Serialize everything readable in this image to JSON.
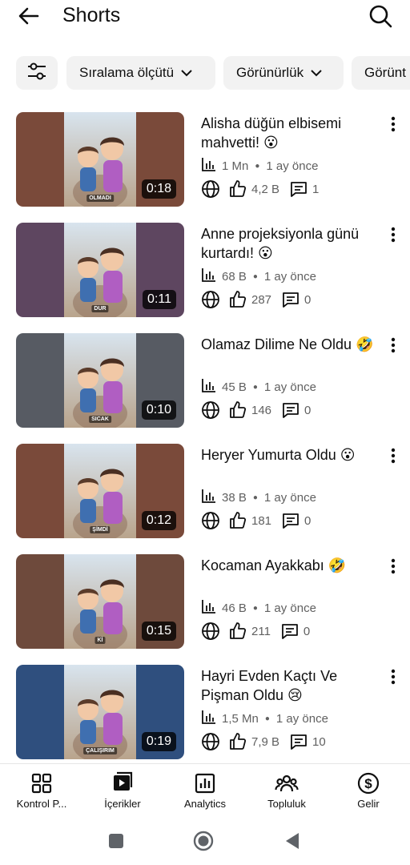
{
  "header": {
    "title": "Shorts"
  },
  "filters": {
    "sort_label": "Sıralama ölçütü",
    "visibility_label": "Görünürlük",
    "visibility2_label": "Görünt"
  },
  "videos": [
    {
      "title": "Alisha düğün elbisemi mahvetti! 😮",
      "duration": "0:18",
      "views": "1 Mn",
      "age": "1 ay önce",
      "likes": "4,2 B",
      "comments": "1",
      "caption": "OLMADI",
      "bg": "#7a4a3a"
    },
    {
      "title": "Anne projeksiyonla günü kurtardı! 😮",
      "duration": "0:11",
      "views": "68 B",
      "age": "1 ay önce",
      "likes": "287",
      "comments": "0",
      "caption": "DUR",
      "bg": "#5e4660"
    },
    {
      "title": "Olamaz Dilime Ne Oldu 🤣",
      "duration": "0:10",
      "views": "45 B",
      "age": "1 ay önce",
      "likes": "146",
      "comments": "0",
      "caption": "SICAK",
      "bg": "#575b63"
    },
    {
      "title": "Heryer Yumurta Oldu 😮",
      "duration": "0:12",
      "views": "38 B",
      "age": "1 ay önce",
      "likes": "181",
      "comments": "0",
      "caption": "ŞİMDİ",
      "bg": "#7a4a3a"
    },
    {
      "title": "Kocaman Ayakkabı 🤣",
      "duration": "0:15",
      "views": "46 B",
      "age": "1 ay önce",
      "likes": "211",
      "comments": "0",
      "caption": "Kİ",
      "bg": "#6e4a3c"
    },
    {
      "title": "Hayri Evden Kaçtı Ve Pişman Oldu 😢",
      "duration": "0:19",
      "views": "1,5 Mn",
      "age": "1 ay önce",
      "likes": "7,9 B",
      "comments": "10",
      "caption": "ÇALIŞIRIM",
      "bg": "#2f4f7e"
    }
  ],
  "bottom_nav": [
    {
      "label": "Kontrol P...",
      "icon": "dashboard-icon"
    },
    {
      "label": "İçerikler",
      "icon": "content-icon"
    },
    {
      "label": "Analytics",
      "icon": "analytics-icon"
    },
    {
      "label": "Topluluk",
      "icon": "community-icon"
    },
    {
      "label": "Gelir",
      "icon": "earn-icon"
    }
  ],
  "colors": {
    "text_primary": "#0f0f0f",
    "text_secondary": "#606060",
    "chip_bg": "#f2f2f2"
  }
}
